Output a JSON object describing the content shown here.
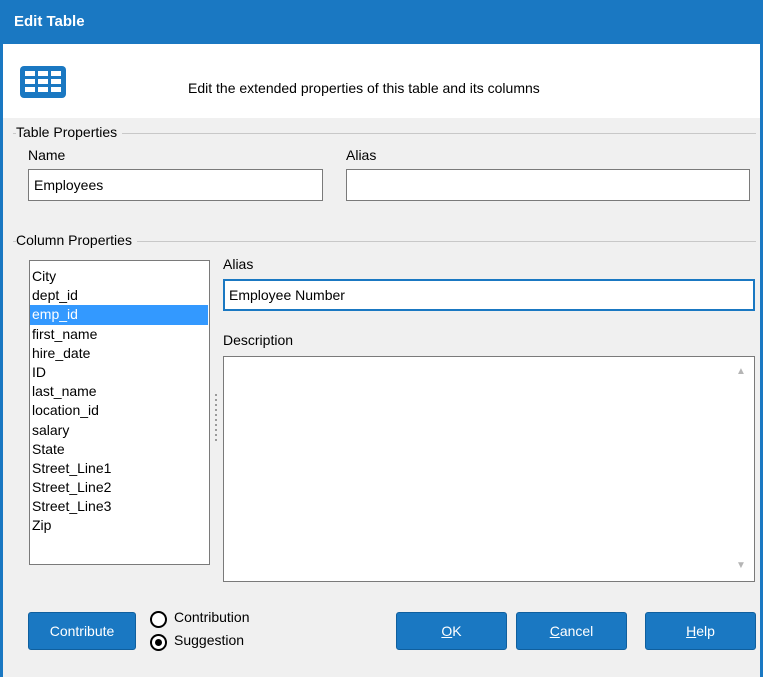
{
  "window": {
    "title": "Edit Table"
  },
  "header": {
    "icon": "table-grid-icon",
    "text": "Edit the extended properties of this table and its columns"
  },
  "table_properties": {
    "group_label": "Table Properties",
    "name_label": "Name",
    "name_value": "Employees",
    "alias_label": "Alias",
    "alias_value": ""
  },
  "column_properties": {
    "group_label": "Column Properties",
    "columns": [
      "City",
      "dept_id",
      "emp_id",
      "first_name",
      "hire_date",
      "ID",
      "last_name",
      "location_id",
      "salary",
      "State",
      "Street_Line1",
      "Street_Line2",
      "Street_Line3",
      "Zip"
    ],
    "selected": "emp_id",
    "alias_label": "Alias",
    "alias_value": "Employee Number",
    "description_label": "Description",
    "description_value": ""
  },
  "footer": {
    "contribute_label": "Contribute",
    "radio_options": [
      "Contribution",
      "Suggestion"
    ],
    "radio_selected": "Suggestion",
    "ok_prefix": "",
    "ok_mnemonic": "O",
    "ok_rest": "K",
    "cancel_mnemonic": "C",
    "cancel_rest": "ancel",
    "help_mnemonic": "H",
    "help_rest": "elp"
  },
  "colors": {
    "accent": "#1a78c2",
    "selection": "#3399ff",
    "background": "#f0f0f0"
  }
}
